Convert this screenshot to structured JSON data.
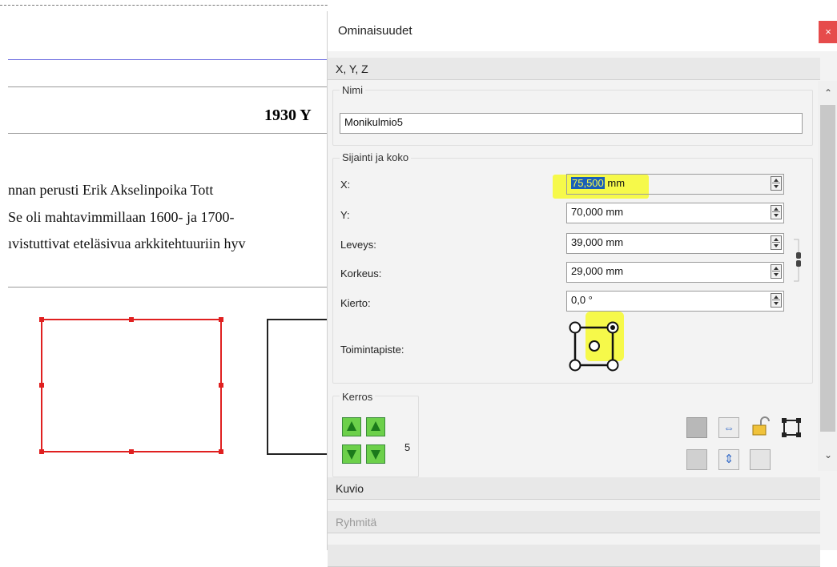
{
  "document": {
    "heading": "1930 Y",
    "paragraph_lines": [
      "nnan perusti Erik Akselinpoika Tott",
      " Se oli mahtavimmillaan 1600- ja 1700-",
      "ıvistuttivat eteläsivua arkkitehtuuriin hyv"
    ]
  },
  "panel": {
    "title": "Ominaisuudet",
    "close_label": "×",
    "sections": {
      "xyz": "X, Y, Z",
      "kuvio": "Kuvio",
      "ryhmita": "Ryhmitä"
    },
    "name_group": {
      "label": "Nimi",
      "value": "Monikulmio5"
    },
    "position_group": {
      "label": "Sijainti ja koko",
      "fields": {
        "x": {
          "label": "X:",
          "value": "75,500",
          "unit": " mm"
        },
        "y": {
          "label": "Y:",
          "value": "70,000 mm"
        },
        "width": {
          "label": "Leveys:",
          "value": "39,000 mm"
        },
        "height": {
          "label": "Korkeus:",
          "value": "29,000 mm"
        },
        "rotation": {
          "label": "Kierto:",
          "value": "0,0 °"
        }
      },
      "basepoint_label": "Toimintapiste:"
    },
    "layer_group": {
      "label": "Kerros",
      "value": "5"
    }
  },
  "colors": {
    "selection": "#e02020",
    "highlight": "#f6f94a",
    "close_button": "#e64b4b"
  }
}
